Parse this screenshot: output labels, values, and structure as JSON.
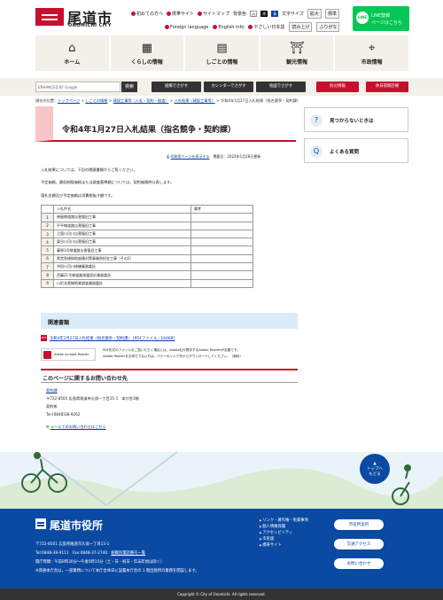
{
  "header": {
    "logo_title": "尾道市",
    "logo_sub": "ONOMICHI CITY",
    "util1": [
      "文字サイズ",
      "初めての方へ",
      "携帯サイト",
      "サイトマップ",
      "背景色"
    ],
    "bg_white": "白",
    "bg_black": "黒",
    "bg_blue": "青",
    "font_size_label": "文字サイズ",
    "font_big": "拡大",
    "font_std": "標準",
    "util2": [
      "Foreign language",
      "English info",
      "やさしい日本語",
      "読み上げ",
      "ふりがな"
    ],
    "line_t1": "LINE登録",
    "line_t2": "ページはこちら",
    "line_icon_text": "LINE"
  },
  "gnav": [
    {
      "label": "ホーム",
      "icon": "⌂"
    },
    {
      "label": "くらしの情報",
      "icon": "▦"
    },
    {
      "label": "しごとの情報",
      "icon": "▤"
    },
    {
      "label": "観光情報",
      "icon": "⛩"
    },
    {
      "label": "市政情報",
      "icon": "⌖"
    }
  ],
  "search": {
    "placeholder": "ENHANCED BY Google",
    "button": "検索"
  },
  "quick_buttons": [
    {
      "label": "組織でさがす",
      "color": "#333333"
    },
    {
      "label": "カレンダーでさがす",
      "color": "#333333"
    },
    {
      "label": "地図でさがす",
      "color": "#333333"
    },
    {
      "label": "防災情報",
      "color": "#c8102e"
    },
    {
      "label": "休日夜間診療",
      "color": "#c8102e"
    }
  ],
  "breadcrumb": {
    "prefix": "現在の位置：",
    "items": [
      "トップページ",
      "しごとの情報",
      "建設工事等（入札・契約・検査）",
      "入札結果（建設工事等）"
    ],
    "current": "令和4年1月27日入札結果（指名競争・契約課）"
  },
  "article": {
    "title": "令和4年1月27日入札結果（指名競争・契約課）",
    "print_link": "印刷用ページを表示する",
    "date": "掲載日：2022年1月28日更新",
    "para1": "入札結果については，下記の関連書類からご覧ください。",
    "para2": "予定価格，最低制限価格または調査基準額については，契約後随時公表します。",
    "para3": "落札金額及び予定価格は消費税抜き額です。",
    "table_header": [
      "",
      "入札件名",
      "備考"
    ],
    "rows": [
      {
        "no": "1",
        "name": "神屋線道路災害復旧工事",
        "note": ""
      },
      {
        "no": "2",
        "name": "平平線道路災害復旧工事",
        "note": ""
      },
      {
        "no": "3",
        "name": "江国川河川災害復旧工事",
        "note": ""
      },
      {
        "no": "4",
        "name": "栗谷川河川災害復旧工事",
        "note": ""
      },
      {
        "no": "5",
        "name": "藤原1号線道路災害復旧工事",
        "note": ""
      },
      {
        "no": "6",
        "name": "県営急傾斜地崩壊対策事業負担金工事（その2）",
        "note": ""
      },
      {
        "no": "7",
        "name": "沖田川河川修繕業務委託",
        "note": ""
      },
      {
        "no": "8",
        "name": "西藤21号線道路測量設計業務委託",
        "note": ""
      },
      {
        "no": "9",
        "name": "川尻北奥線地質調査業務委託",
        "note": ""
      }
    ],
    "related_title": "関連書類",
    "pdf_link": "令和4年1月27日入札結果（指名競争・契約課） [PDFファイル／164KB]",
    "pdf_icon": "PDF",
    "reader_label": "Adobe Acrobat Reader",
    "reader_note1": "PDF形式のファイルをご覧いただく場合には，Adobe社が提供するAdobe Readerが必要です。",
    "reader_note2": "Adobe Readerをお持ちでない方は，バナーのリンク先からダウンロードしてください。（無料）",
    "inquiry_title": "このページに関するお問い合わせ先",
    "dept": "契約課",
    "address": "〒722-8501 広島県尾道市久保一丁目15-1　本庁舎3階",
    "section": "契約係",
    "tel": "Tel:(0848)38-9262",
    "mail_link": "メールでのお問い合わせはこちら"
  },
  "sidebar": [
    {
      "label": "見つからないときは",
      "icon": "?"
    },
    {
      "label": "よくある質問",
      "icon": "Q"
    }
  ],
  "totop": [
    "トップへ",
    "もどる"
  ],
  "footer": {
    "title": "尾道市役所",
    "address": "〒722-8501 広島県尾道市久保一丁目15-1",
    "tel": "Tel:0848-38-9111",
    "fax": "Fax:0848-37-2740",
    "org_link": "組織別電話番号一覧",
    "hours": "開庁時間：午前8時30分〜午後5時15分（土・日・祝日・年末年始は除く）",
    "note": "※発通本庁舎は，一部業務について本庁舎休日に設置本庁舎の 1 階出張所の業務を開設します。",
    "links": [
      "リンク・著作権・免責事項",
      "個人情報保護",
      "アクセシビリティ",
      "市民版",
      "携帯サイト"
    ],
    "buttons": [
      "市役所案内",
      "交通アクセス",
      "お問い合わせ"
    ],
    "copyright": "Copyright © City of Onomichi. All rights reserved."
  }
}
